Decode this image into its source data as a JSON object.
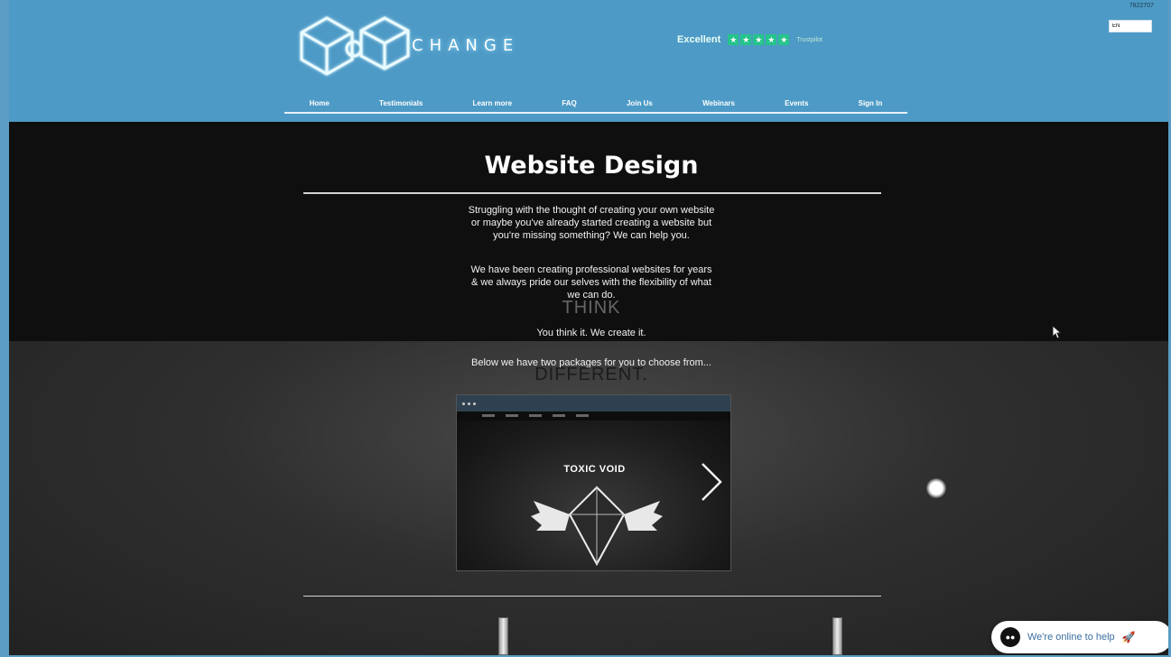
{
  "header": {
    "logo_text": "CHANGE",
    "rating": {
      "label": "Excellent",
      "stars": [
        "★",
        "★",
        "★",
        "★",
        "★"
      ],
      "provider": "Trustpilot"
    },
    "visitor_counter": "7822707",
    "lang_input_value": "EN"
  },
  "nav": {
    "items": [
      {
        "label": "Home"
      },
      {
        "label": "Testimonials"
      },
      {
        "label": "Learn more"
      },
      {
        "label": "FAQ"
      },
      {
        "label": "Join Us"
      },
      {
        "label": "Webinars"
      },
      {
        "label": "Events"
      },
      {
        "label": "Sign In"
      }
    ]
  },
  "main": {
    "title": "Website Design",
    "para_1": "Struggling with the thought of creating your own website or maybe you've already started creating a website but you're missing something? We can help you.",
    "para_2": "We have been creating professional websites for years & we always pride our selves with the flexibility of what we can do.",
    "tagline": "You think it. We create it.",
    "packages_intro": "Below we have two packages for you to choose from...",
    "overlay_think": "THINK",
    "overlay_different": "DIFFERENT."
  },
  "preview": {
    "title": "TOXIC VOID"
  },
  "chat": {
    "avatar": "●●",
    "label": "We're online to help",
    "icon": "rocket-icon"
  },
  "colors": {
    "header_bg": "#4d9ac6",
    "trust_green": "#25c48a",
    "page_bg": "#1d1d1d"
  }
}
